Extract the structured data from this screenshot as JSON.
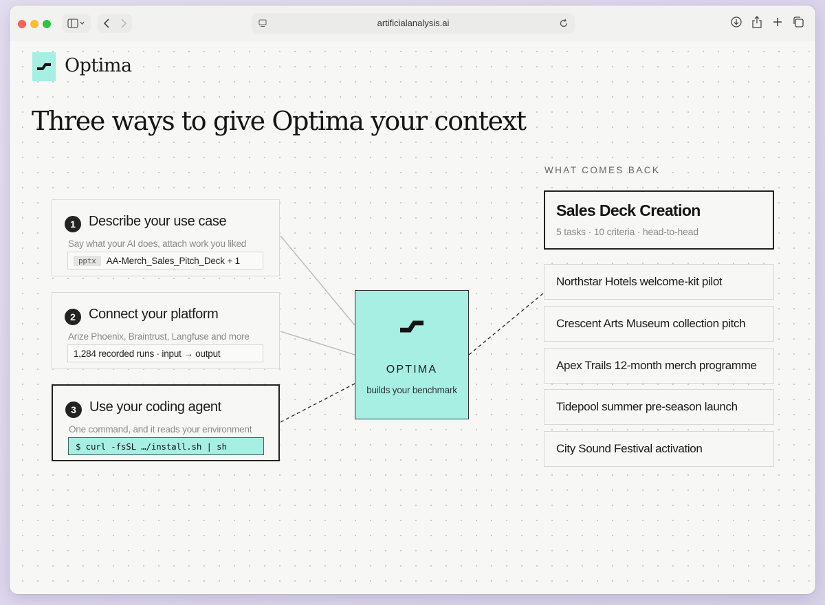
{
  "browser": {
    "url": "artificialanalysis.ai"
  },
  "brand": {
    "name": "Optima",
    "accent_color": "#a7eee3"
  },
  "page": {
    "title": "Three ways to give Optima your context"
  },
  "ways": [
    {
      "number": "1",
      "title": "Describe your use case",
      "subtitle": "Say what your AI does, attach work you liked",
      "badge": "pptx",
      "value": "AA-Merch_Sales_Pitch_Deck + 1"
    },
    {
      "number": "2",
      "title": "Connect your platform",
      "subtitle": "Arize Phoenix, Braintrust, Langfuse and more",
      "value": "1,284 recorded runs · input → output"
    },
    {
      "number": "3",
      "title": "Use your coding agent",
      "subtitle": "One command, and it reads your environment",
      "value": "$ curl -fsSL …/install.sh | sh"
    }
  ],
  "center": {
    "title": "OPTIMA",
    "subtitle": "builds your benchmark"
  },
  "results": {
    "label": "WHAT COMES BACK",
    "title": "Sales Deck Creation",
    "meta": "5 tasks · 10 criteria · head-to-head",
    "tasks": [
      "Northstar Hotels welcome-kit pilot",
      "Crescent Arts Museum collection pitch",
      "Apex Trails 12-month merch programme",
      "Tidepool summer pre-season launch",
      "City Sound Festival activation"
    ]
  }
}
